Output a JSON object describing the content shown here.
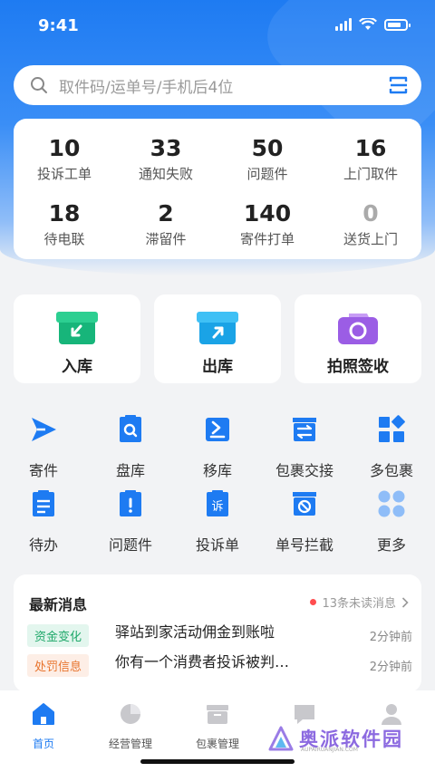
{
  "status": {
    "time": "9:41"
  },
  "search": {
    "placeholder": "取件码/运单号/手机后4位"
  },
  "stats": [
    {
      "value": "10",
      "label": "投诉工单"
    },
    {
      "value": "33",
      "label": "通知失败"
    },
    {
      "value": "50",
      "label": "问题件"
    },
    {
      "value": "16",
      "label": "上门取件"
    },
    {
      "value": "18",
      "label": "待电联"
    },
    {
      "value": "2",
      "label": "滞留件"
    },
    {
      "value": "140",
      "label": "寄件打单"
    },
    {
      "value": "0",
      "label": "送货上门"
    }
  ],
  "actions": [
    {
      "label": "入库",
      "icon": "inbound-box-icon",
      "color": "#17b57a"
    },
    {
      "label": "出库",
      "icon": "outbound-box-icon",
      "color": "#1aa3e6"
    },
    {
      "label": "拍照签收",
      "icon": "camera-icon",
      "color": "#9b5de5"
    }
  ],
  "grid": [
    {
      "label": "寄件",
      "icon": "send-icon"
    },
    {
      "label": "盘库",
      "icon": "inventory-icon"
    },
    {
      "label": "移库",
      "icon": "move-icon"
    },
    {
      "label": "包裹交接",
      "icon": "handover-icon"
    },
    {
      "label": "多包裹",
      "icon": "multi-package-icon"
    },
    {
      "label": "待办",
      "icon": "todo-icon"
    },
    {
      "label": "问题件",
      "icon": "problem-icon"
    },
    {
      "label": "投诉单",
      "icon": "complaint-icon"
    },
    {
      "label": "单号拦截",
      "icon": "intercept-icon"
    },
    {
      "label": "更多",
      "icon": "more-icon"
    }
  ],
  "messages": {
    "title": "最新消息",
    "unread": "13条未读消息",
    "items": [
      {
        "tag": "资金变化",
        "text": "驿站到家活动佣金到账啦",
        "time": "2分钟前"
      },
      {
        "tag": "处罚信息",
        "text": "你有一个消费者投诉被判…",
        "time": "2分钟前"
      }
    ]
  },
  "tabs": [
    {
      "label": "首页",
      "icon": "home-icon"
    },
    {
      "label": "经营管理",
      "icon": "pie-chart-icon"
    },
    {
      "label": "包裹管理",
      "icon": "package-icon"
    },
    {
      "label": "",
      "icon": "message-icon"
    },
    {
      "label": "",
      "icon": "profile-icon"
    }
  ],
  "watermark": {
    "text": "奥派软件园",
    "sub": "AUPAIRUANJIAN.COM"
  },
  "colors": {
    "primary": "#1e7bf2",
    "icon_blue": "#1e7bf2",
    "alert": "#ff4d4f"
  }
}
